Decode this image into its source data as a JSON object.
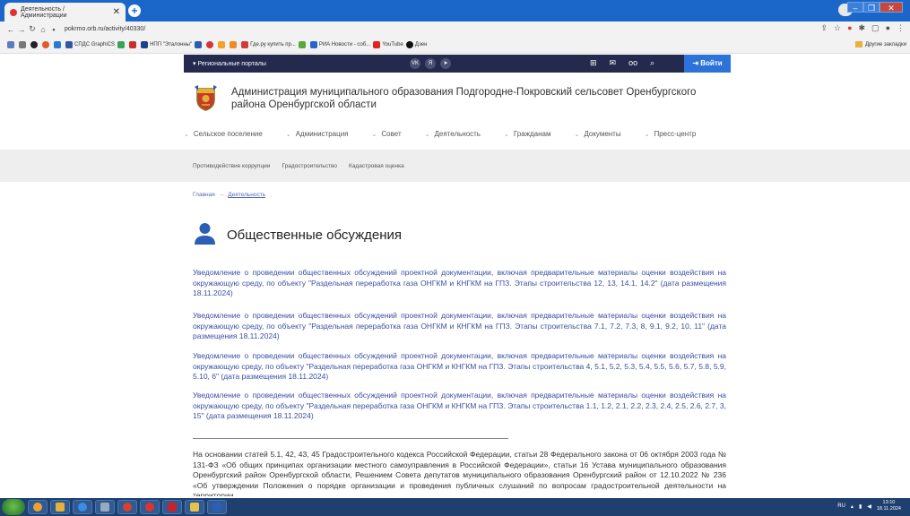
{
  "browser": {
    "tab_title": "Деятельность / Администрации",
    "new_tab": "+",
    "url": "pokrmo.orb.ru/activity/40330/",
    "window_buttons": [
      "–",
      "❐",
      "✕"
    ],
    "bookmarks": [
      "",
      "",
      "",
      "",
      "",
      "СПДС GraphiCS",
      "",
      "",
      "НПП \"Эталонны\"",
      "",
      "",
      "",
      "",
      "Где.ру купить пр...",
      "",
      "РИА Новости - соб...",
      "YouTube",
      "Дзен"
    ],
    "other_bookmarks": "Другие закладки"
  },
  "site": {
    "regional_portals": "Региональные порталы",
    "social": [
      "VK",
      "Я",
      "➤"
    ],
    "login": "Войти",
    "org_title": "Администрация муниципального образования Подгородне-Покровский сельсовет Оренбургского района Оренбургской области",
    "main_nav": [
      "Сельское поселение",
      "Администрация",
      "Совет",
      "Деятельность",
      "Гражданам",
      "Документы",
      "Пресс-центр"
    ],
    "sub_nav": [
      "Противодействие коррупции",
      "Градостроительство",
      "Кадастровая оценка"
    ],
    "breadcrumbs": {
      "home": "Главная",
      "sep": "→",
      "current": "Деятельность"
    },
    "page_title": "Общественные обсуждения",
    "notices": [
      "Уведомление о проведении общественных обсуждений проектной документации, включая предварительные материалы оценки воздействия на окружающую среду, по объекту \"Раздельная переработка газа ОНГКМ и КНГКМ на ГПЗ. Этапы строительства 12, 13, 14.1, 14.2\" (дата размещения 18.11.2024)",
      "Уведомление о проведении общественных обсуждений проектной документации, включая предварительные материалы оценки воздействия на окружающую среду, по объекту \"Раздельная переработка газа ОНГКМ и КНГКМ на ГПЗ. Этапы строительства 7.1, 7.2, 7.3, 8, 9.1, 9.2, 10, 11\" (дата размещения 18.11.2024)",
      "Уведомление о проведении общественных обсуждений проектной документации, включая предварительные материалы оценки воздействия на окружающую среду, по объекту \"Раздельная переработка газа ОНГКМ и КНГКМ на ГПЗ. Этапы строительства 4, 5.1, 5.2, 5.3, 5.4, 5.5, 5.6, 5.7, 5.8, 5.9, 5.10, 6\" (дата размещения 18.11.2024)",
      "Уведомление о проведении общественных обсуждений проектной документации, включая предварительные материалы оценки воздействия на окружающую среду, по объекту \"Раздельная переработка газа ОНГКМ и КНГКМ на ГПЗ. Этапы строительства 1.1, 1.2, 2.1, 2.2, 2.3, 2.4, 2.5, 2.6, 2.7, 3, 15\" (дата размещения 18.11.2024)"
    ],
    "body_text": "На основании статей 5.1, 42, 43, 45 Градостроительного кодекса Российской Федерации, статьи 28 Федерального закона от 06 октября 2003 года № 131-ФЗ «Об общих принципах организации местного самоуправления в Российской Федерации», статьи 16 Устава муниципального образования Оренбургский район Оренбургской области, Решением Совета депутатов муниципального образования Оренбургский район от 12.10.2022 № 236 «Об утверждении Положения о порядке организации и проведения публичных слушаний по вопросам градостроительной деятельности на территории"
  },
  "taskbar": {
    "lang": "RU",
    "time": "13:10",
    "date": "18.11.2024"
  },
  "colors": {
    "tabbar": "#1b67c9",
    "sitebar": "#232a4d",
    "login": "#2b72d9",
    "link": "#3a4fa3",
    "taskbar": "#1f3f6e"
  }
}
